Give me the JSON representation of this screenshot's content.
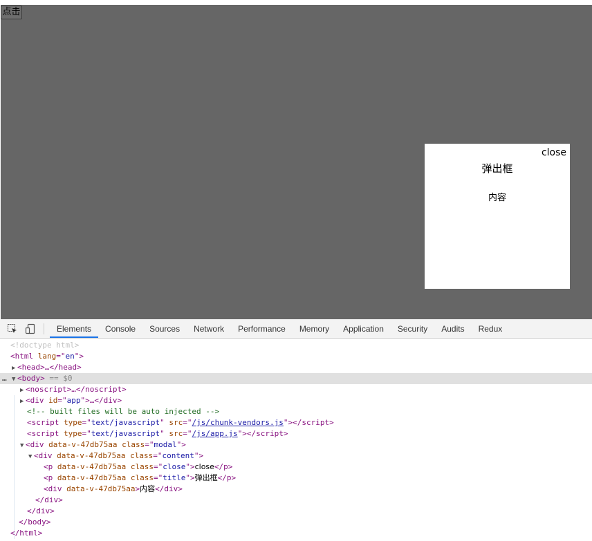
{
  "page": {
    "button_label": "点击",
    "modal": {
      "close": "close",
      "title": "弹出框",
      "content": "内容"
    }
  },
  "devtools": {
    "tabs": [
      "Elements",
      "Console",
      "Sources",
      "Network",
      "Performance",
      "Memory",
      "Application",
      "Security",
      "Audits",
      "Redux"
    ],
    "active_tab": "Elements",
    "selected_suffix": "== $0",
    "dom_lines": {
      "doctype": "<!doctype html>",
      "html_open": [
        "<html ",
        "lang",
        "=\"",
        "en",
        "\">"
      ],
      "head": "<head>…</head>",
      "body_open": "<body>",
      "noscript": "<noscript>…</noscript>",
      "div_app": [
        "<div ",
        "id",
        "=\"",
        "app",
        "\">…</div>"
      ],
      "comment": "<!-- built files will be auto injected -->",
      "script1_src": "/js/chunk-vendors.js",
      "script2_src": "/js/app.js",
      "script_type": "text/javascript",
      "data_attr": "data-v-47db75aa",
      "class_modal": "modal",
      "class_content": "content",
      "class_close": "close",
      "class_title": "title",
      "close_text": "close",
      "title_text": "弹出框",
      "content_text": "内容"
    }
  }
}
